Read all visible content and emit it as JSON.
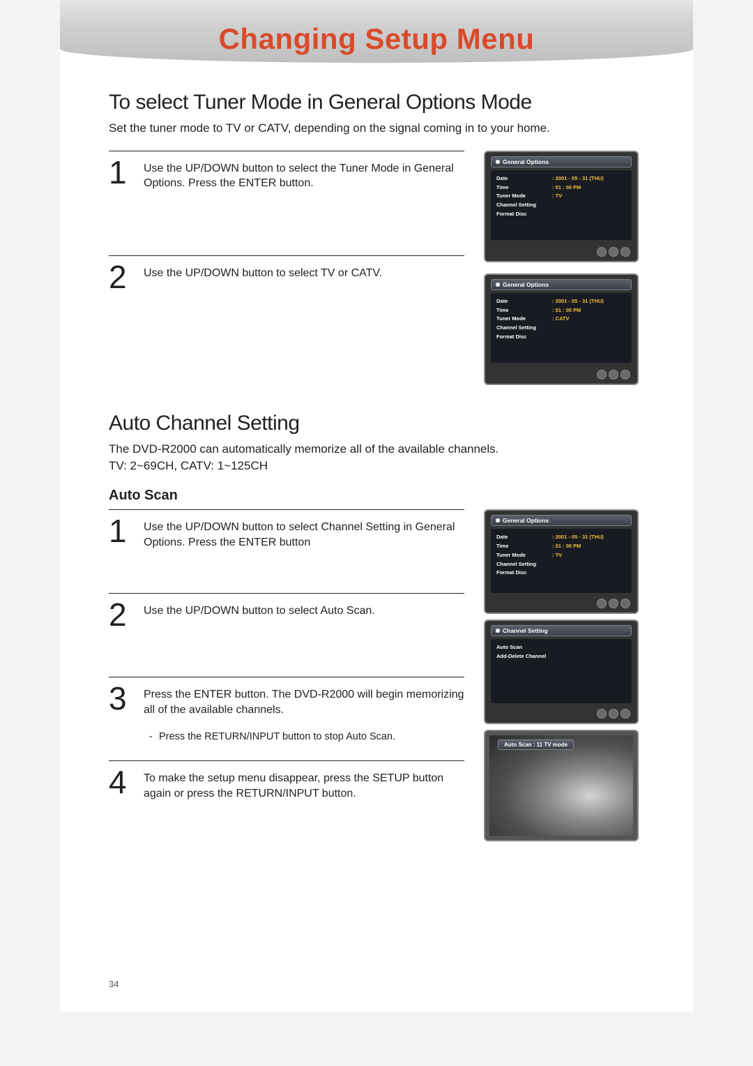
{
  "header": {
    "title": "Changing Setup Menu"
  },
  "section1": {
    "title": "To select Tuner Mode in General Options Mode",
    "subtitle": "Set the tuner mode to TV or CATV, depending on the signal coming in to your home.",
    "steps": [
      {
        "num": "1",
        "text": "Use the UP/DOWN button to select the Tuner Mode in General Options. Press the ENTER button."
      },
      {
        "num": "2",
        "text": "Use the UP/DOWN button to select TV or CATV."
      }
    ]
  },
  "section2": {
    "title": "Auto Channel Setting",
    "subtitle": "The DVD-R2000 can automatically memorize all of the available channels.\nTV: 2~69CH, CATV: 1~125CH",
    "sub_heading": "Auto Scan",
    "steps": [
      {
        "num": "1",
        "text": "Use the UP/DOWN button to select Channel Setting in General Options. Press the ENTER button"
      },
      {
        "num": "2",
        "text": "Use the UP/DOWN button to select Auto Scan."
      },
      {
        "num": "3",
        "text": "Press the ENTER button. The DVD-R2000 will begin memorizing all of the available channels.",
        "note": "Press the RETURN/INPUT button to stop Auto Scan."
      },
      {
        "num": "4",
        "text": "To make the setup menu disappear, press the SETUP button again or press the RETURN/INPUT button."
      }
    ]
  },
  "osd": {
    "general_title": "General Options",
    "channel_title": "Channel Setting",
    "rows_tv": [
      {
        "label": "Date",
        "val": ": 2001 - 05 - 31 (THU)"
      },
      {
        "label": "Time",
        "val": ": 01  :  00  PM"
      },
      {
        "label": "Tuner Mode",
        "val": ": TV"
      },
      {
        "label": "Channel Setting",
        "val": ""
      },
      {
        "label": "Format Disc",
        "val": ""
      }
    ],
    "rows_catv": [
      {
        "label": "Date",
        "val": ": 2001 - 05 - 31 (THU)"
      },
      {
        "label": "Time",
        "val": ": 01  :  00  PM"
      },
      {
        "label": "Tuner Mode",
        "val": ": CATV"
      },
      {
        "label": "Channel Setting",
        "val": ""
      },
      {
        "label": "Format Disc",
        "val": ""
      }
    ],
    "channel_rows": [
      {
        "label": "Auto Scan",
        "val": ""
      },
      {
        "label": "Add-Delete Channel",
        "val": ""
      }
    ],
    "scan_bar": "Auto Scan : 11    TV mode"
  },
  "page_number": "34"
}
